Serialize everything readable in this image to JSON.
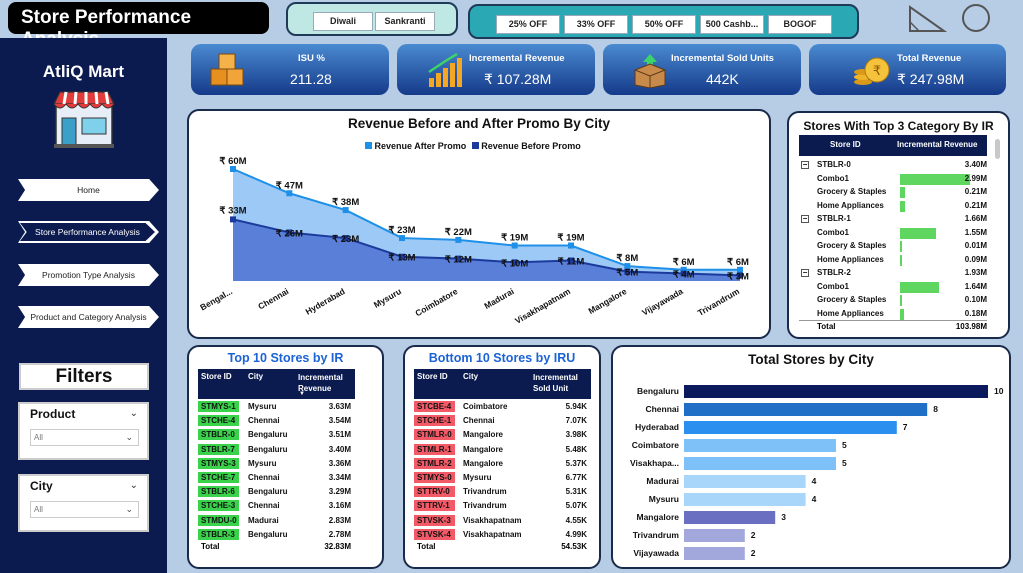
{
  "header": {
    "title": "Store Performance Analysis",
    "festivals": [
      "Diwali",
      "Sankranti"
    ],
    "promos": [
      "25% OFF",
      "33% OFF",
      "50% OFF",
      "500 Cashb...",
      "BOGOF"
    ]
  },
  "sidebar": {
    "brand": "AtliQ Mart",
    "nav": [
      "Home",
      "Store Performance Analysis",
      "Promotion Type Analysis",
      "Product and Category Analysis"
    ],
    "active_index": 1,
    "filters_label": "Filters",
    "slicers": [
      {
        "label": "Product",
        "value": "All"
      },
      {
        "label": "City",
        "value": "All"
      }
    ]
  },
  "kpis": [
    {
      "title": "ISU %",
      "value": "211.28",
      "icon": "boxes-icon"
    },
    {
      "title": "Incremental Revenue",
      "value": "₹ 107.28M",
      "icon": "revenue-growth-icon"
    },
    {
      "title": "Incremental Sold Units",
      "value": "442K",
      "icon": "box-up-icon"
    },
    {
      "title": "Total Revenue",
      "value": "₹ 247.98M",
      "icon": "rupee-coins-icon"
    }
  ],
  "chart_data": [
    {
      "type": "area",
      "title": "Revenue Before and After Promo By City",
      "categories": [
        "Bengal...",
        "Chennai",
        "Hyderabad",
        "Mysuru",
        "Coimbatore",
        "Madurai",
        "Visakhapatnam",
        "Mangalore",
        "Vijayawada",
        "Trivandrum"
      ],
      "series": [
        {
          "name": "Revenue After Promo",
          "values": [
            60,
            47,
            38,
            23,
            22,
            19,
            19,
            8,
            6,
            6
          ],
          "labels": [
            "₹ 60M",
            "₹ 47M",
            "₹ 38M",
            "₹ 23M",
            "₹ 22M",
            "₹ 19M",
            "₹ 19M",
            "₹ 8M",
            "₹ 6M",
            "₹ 6M"
          ],
          "color": "#1e90e8"
        },
        {
          "name": "Revenue Before Promo",
          "values": [
            33,
            26,
            23,
            13,
            12,
            10,
            11,
            5,
            4,
            3
          ],
          "labels": [
            "₹ 33M",
            "₹ 26M",
            "₹ 23M",
            "₹ 13M",
            "₹ 12M",
            "₹ 10M",
            "₹ 11M",
            "₹ 5M",
            "₹ 4M",
            "₹ 3M"
          ],
          "color": "#1c3a9c"
        }
      ],
      "legend": "top"
    },
    {
      "type": "bar",
      "title": "Total Stores by City",
      "categories": [
        "Bengaluru",
        "Chennai",
        "Hyderabad",
        "Coimbatore",
        "Visakhapa...",
        "Madurai",
        "Mysuru",
        "Mangalore",
        "Trivandrum",
        "Vijayawada"
      ],
      "values": [
        10,
        8,
        7,
        5,
        5,
        4,
        4,
        3,
        2,
        2
      ],
      "orientation": "horizontal",
      "colors": [
        "#0b1a5c",
        "#1f6fc6",
        "#2b8ff0",
        "#7ec0f8",
        "#7ec0f8",
        "#a8d6fb",
        "#a8d6fb",
        "#6a6fc2",
        "#a3a8dc",
        "#a3a8dc"
      ]
    }
  ],
  "top_category": {
    "title": "Stores With Top 3 Category By IR",
    "headers": [
      "Store ID",
      "Incremental Revenue"
    ],
    "rows": [
      {
        "label": "STBLR-0",
        "value": "3.40M",
        "kind": "store",
        "bar": 0
      },
      {
        "label": "Combo1",
        "value": "2.99M",
        "kind": "cat",
        "bar": 2.99
      },
      {
        "label": "Grocery & Staples",
        "value": "0.21M",
        "kind": "cat",
        "bar": 0.21
      },
      {
        "label": "Home Appliances",
        "value": "0.21M",
        "kind": "cat",
        "bar": 0.21
      },
      {
        "label": "STBLR-1",
        "value": "1.66M",
        "kind": "store",
        "bar": 0
      },
      {
        "label": "Combo1",
        "value": "1.55M",
        "kind": "cat",
        "bar": 1.55
      },
      {
        "label": "Grocery & Staples",
        "value": "0.01M",
        "kind": "cat",
        "bar": 0.01
      },
      {
        "label": "Home Appliances",
        "value": "0.09M",
        "kind": "cat",
        "bar": 0.09
      },
      {
        "label": "STBLR-2",
        "value": "1.93M",
        "kind": "store",
        "bar": 0
      },
      {
        "label": "Combo1",
        "value": "1.64M",
        "kind": "cat",
        "bar": 1.64
      },
      {
        "label": "Grocery & Staples",
        "value": "0.10M",
        "kind": "cat",
        "bar": 0.1
      },
      {
        "label": "Home Appliances",
        "value": "0.18M",
        "kind": "cat",
        "bar": 0.18
      }
    ],
    "total_label": "Total",
    "total_value": "103.98M"
  },
  "top10": {
    "title": "Top 10 Stores by IR",
    "headers": [
      "Store ID",
      "City",
      "Incremental Revenue"
    ],
    "rows": [
      [
        "STMYS-1",
        "Mysuru",
        "3.63M"
      ],
      [
        "STCHE-4",
        "Chennai",
        "3.54M"
      ],
      [
        "STBLR-0",
        "Bengaluru",
        "3.51M"
      ],
      [
        "STBLR-7",
        "Bengaluru",
        "3.40M"
      ],
      [
        "STMYS-3",
        "Mysuru",
        "3.36M"
      ],
      [
        "STCHE-7",
        "Chennai",
        "3.34M"
      ],
      [
        "STBLR-6",
        "Bengaluru",
        "3.29M"
      ],
      [
        "STCHE-3",
        "Chennai",
        "3.16M"
      ],
      [
        "STMDU-0",
        "Madurai",
        "2.83M"
      ],
      [
        "STBLR-3",
        "Bengaluru",
        "2.78M"
      ]
    ],
    "total_label": "Total",
    "total_value": "32.83M"
  },
  "bottom10": {
    "title": "Bottom 10 Stores by IRU",
    "headers": [
      "Store ID",
      "City",
      "Incremental Sold Unit"
    ],
    "rows": [
      [
        "STCBE-4",
        "Coimbatore",
        "5.94K"
      ],
      [
        "STCHE-1",
        "Chennai",
        "7.07K"
      ],
      [
        "STMLR-0",
        "Mangalore",
        "3.98K"
      ],
      [
        "STMLR-1",
        "Mangalore",
        "5.48K"
      ],
      [
        "STMLR-2",
        "Mangalore",
        "5.37K"
      ],
      [
        "STMYS-0",
        "Mysuru",
        "6.77K"
      ],
      [
        "STTRV-0",
        "Trivandrum",
        "5.31K"
      ],
      [
        "STTRV-1",
        "Trivandrum",
        "5.07K"
      ],
      [
        "STVSK-3",
        "Visakhapatnam",
        "4.55K"
      ],
      [
        "STVSK-4",
        "Visakhapatnam",
        "4.99K"
      ]
    ],
    "total_label": "Total",
    "total_value": "54.53K"
  },
  "colors": {
    "navy": "#0b1a4f",
    "green": "#39d24a",
    "red": "#f25a67",
    "background": "#b7cde6"
  }
}
